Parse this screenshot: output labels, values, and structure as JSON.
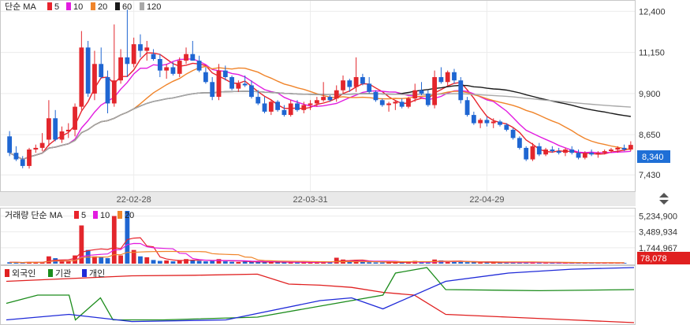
{
  "chart_data": {
    "type": "candlestick",
    "price_panel": {
      "legend_title": "단순 MA",
      "ma_legend": [
        {
          "label": "5",
          "color": "#e8232c"
        },
        {
          "label": "10",
          "color": "#e21ce0"
        },
        {
          "label": "20",
          "color": "#f0842a"
        },
        {
          "label": "60",
          "color": "#1a1a1a"
        },
        {
          "label": "120",
          "color": "#a8a8a8"
        }
      ],
      "y_ticks": [
        "12,400",
        "11,150",
        "9,900",
        "8,650",
        "7,430"
      ],
      "ylim": [
        7100,
        12600
      ],
      "last_price": "8,340",
      "x_labels": [
        "22-02-28",
        "22-03-31",
        "22-04-29"
      ],
      "candles": [
        [
          8600,
          8760,
          8000,
          8100
        ],
        [
          8100,
          8300,
          7850,
          7900
        ],
        [
          7900,
          8000,
          7630,
          7700
        ],
        [
          7700,
          8250,
          7620,
          8200
        ],
        [
          8200,
          8350,
          8100,
          8250
        ],
        [
          8250,
          8700,
          8150,
          8400
        ],
        [
          8500,
          9700,
          8300,
          9150
        ],
        [
          9150,
          9400,
          8450,
          8500
        ],
        [
          8500,
          8900,
          8400,
          8750
        ],
        [
          8750,
          9000,
          8550,
          8800
        ],
        [
          8800,
          9600,
          8600,
          9500
        ],
        [
          9500,
          11800,
          9400,
          11300
        ],
        [
          11300,
          11500,
          9800,
          9900
        ],
        [
          9900,
          11200,
          9700,
          10800
        ],
        [
          10800,
          11300,
          10350,
          10400
        ],
        [
          10400,
          10600,
          9300,
          9600
        ],
        [
          9600,
          12000,
          9500,
          10300
        ],
        [
          10300,
          11250,
          10200,
          11000
        ],
        [
          11000,
          12450,
          10400,
          10800
        ],
        [
          10800,
          11600,
          10700,
          11400
        ],
        [
          11400,
          11700,
          11000,
          11200
        ],
        [
          11200,
          11500,
          10900,
          11300
        ],
        [
          11100,
          11250,
          10900,
          10950
        ],
        [
          10950,
          11100,
          10400,
          10600
        ],
        [
          10600,
          10800,
          10350,
          10700
        ],
        [
          10700,
          10850,
          10450,
          10500
        ],
        [
          10500,
          11000,
          10400,
          10900
        ],
        [
          10900,
          11300,
          10800,
          11100
        ],
        [
          11100,
          11500,
          10900,
          10900
        ],
        [
          10900,
          11050,
          10550,
          10600
        ],
        [
          10550,
          10700,
          10200,
          10250
        ],
        [
          10250,
          10400,
          9700,
          9800
        ],
        [
          9800,
          10800,
          9700,
          10600
        ],
        [
          10600,
          10750,
          10300,
          10400
        ],
        [
          10400,
          10450,
          10000,
          10050
        ],
        [
          10050,
          10300,
          9950,
          10200
        ],
        [
          10200,
          10450,
          10100,
          10150
        ],
        [
          10150,
          10300,
          9750,
          9800
        ],
        [
          9800,
          10000,
          9550,
          9600
        ],
        [
          9600,
          9800,
          9300,
          9350
        ],
        [
          9350,
          9700,
          9250,
          9650
        ],
        [
          9650,
          9700,
          9350,
          9400
        ],
        [
          9400,
          9550,
          9200,
          9250
        ],
        [
          9250,
          9700,
          9200,
          9600
        ],
        [
          9600,
          9700,
          9350,
          9400
        ],
        [
          9400,
          9650,
          9300,
          9550
        ],
        [
          9550,
          9700,
          9400,
          9600
        ],
        [
          9600,
          9800,
          9500,
          9700
        ],
        [
          9700,
          10250,
          9650,
          9800
        ],
        [
          9800,
          9850,
          9650,
          9700
        ],
        [
          9750,
          10150,
          9650,
          10000
        ],
        [
          10000,
          10450,
          9900,
          10300
        ],
        [
          10300,
          10350,
          9950,
          10100
        ],
        [
          10100,
          11000,
          9950,
          10400
        ],
        [
          10400,
          10500,
          10150,
          10200
        ],
        [
          10200,
          10400,
          9900,
          9950
        ],
        [
          9950,
          10000,
          9650,
          9700
        ],
        [
          9700,
          9750,
          9500,
          9550
        ],
        [
          9550,
          9650,
          9350,
          9600
        ],
        [
          9600,
          9700,
          9400,
          9650
        ],
        [
          9650,
          9750,
          9450,
          9500
        ],
        [
          9500,
          9800,
          9450,
          9750
        ],
        [
          9750,
          10200,
          9650,
          10000
        ],
        [
          10000,
          10250,
          9850,
          9900
        ],
        [
          9900,
          10000,
          9500,
          9550
        ],
        [
          9550,
          10600,
          9450,
          10400
        ],
        [
          10400,
          10700,
          10200,
          10250
        ],
        [
          10250,
          10600,
          10150,
          10550
        ],
        [
          10550,
          10650,
          10200,
          10300
        ],
        [
          10300,
          10400,
          9600,
          9700
        ],
        [
          9700,
          9800,
          9200,
          9250
        ],
        [
          9250,
          9350,
          8950,
          9000
        ],
        [
          9000,
          9150,
          8850,
          9100
        ],
        [
          9100,
          9200,
          8900,
          9000
        ],
        [
          9000,
          9150,
          8850,
          9050
        ],
        [
          9050,
          9100,
          8900,
          8950
        ],
        [
          8950,
          9000,
          8750,
          8800
        ],
        [
          8800,
          8850,
          8500,
          8550
        ],
        [
          8550,
          8600,
          8200,
          8250
        ],
        [
          8250,
          8300,
          7850,
          7900
        ],
        [
          7900,
          8400,
          7850,
          8300
        ],
        [
          8300,
          8400,
          8000,
          8050
        ],
        [
          8050,
          8250,
          8000,
          8200
        ],
        [
          8200,
          8300,
          8100,
          8150
        ],
        [
          8150,
          8250,
          8050,
          8100
        ],
        [
          8100,
          8250,
          8000,
          8200
        ],
        [
          8200,
          8300,
          8050,
          8100
        ],
        [
          8100,
          8200,
          7900,
          7950
        ],
        [
          7950,
          8150,
          7900,
          8100
        ],
        [
          8100,
          8200,
          8000,
          8050
        ],
        [
          8050,
          8150,
          7950,
          8100
        ],
        [
          8100,
          8200,
          8050,
          8150
        ],
        [
          8150,
          8250,
          8100,
          8200
        ],
        [
          8200,
          8300,
          8100,
          8250
        ],
        [
          8250,
          8350,
          8150,
          8200
        ],
        [
          8200,
          8450,
          8150,
          8340
        ]
      ]
    },
    "volume_panel": {
      "legend_title": "거래량 단순 MA",
      "ma_legend": [
        {
          "label": "5",
          "color": "#e8232c"
        },
        {
          "label": "10",
          "color": "#e21ce0"
        },
        {
          "label": "20",
          "color": "#f0842a"
        }
      ],
      "y_ticks": [
        "5,234,900",
        "3,489,934",
        "1,744,967"
      ],
      "ylim": [
        0,
        5800000
      ],
      "last_volume": "78,078",
      "volumes": [
        150000,
        120000,
        100000,
        180000,
        150000,
        160000,
        800000,
        600000,
        300000,
        250000,
        900000,
        4200000,
        1500000,
        800000,
        700000,
        600000,
        5234900,
        900000,
        5800000,
        1500000,
        800000,
        700000,
        400000,
        300000,
        350000,
        250000,
        400000,
        500000,
        400000,
        300000,
        250000,
        300000,
        500000,
        250000,
        200000,
        180000,
        220000,
        200000,
        180000,
        150000,
        200000,
        150000,
        140000,
        150000,
        120000,
        150000,
        130000,
        140000,
        200000,
        150000,
        650000,
        450000,
        250000,
        400000,
        200000,
        150000,
        130000,
        120000,
        150000,
        130000,
        120000,
        180000,
        300000,
        150000,
        120000,
        450000,
        350000,
        250000,
        200000,
        180000,
        160000,
        140000,
        120000,
        130000,
        110000,
        100000,
        90000,
        120000,
        150000,
        160000,
        110000,
        90000,
        80000,
        85000,
        80000,
        85000,
        80000,
        90000,
        85000,
        80000,
        80000,
        82000,
        85000,
        80000,
        78078
      ]
    },
    "investor_panel": {
      "legend": [
        {
          "label": "외국인",
          "color": "#e02020"
        },
        {
          "label": "기관",
          "color": "#1c8c1c"
        },
        {
          "label": "개인",
          "color": "#1f2ad8"
        }
      ]
    }
  }
}
